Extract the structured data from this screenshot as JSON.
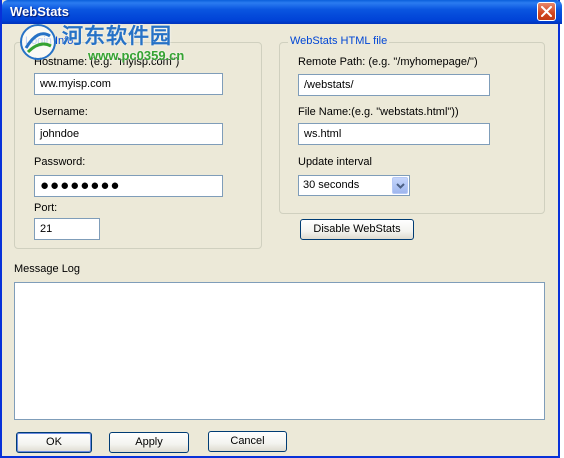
{
  "window": {
    "title": "WebStats"
  },
  "watermark": {
    "site_name": "河东软件园",
    "url": "www.pc0359.cn"
  },
  "login_info": {
    "group_title": "Login Info",
    "hostname_label": "Hostname: (e.g. \"myisp.com\")",
    "hostname_value": "ww.myisp.com",
    "username_label": "Username:",
    "username_value": "johndoe",
    "password_label": "Password:",
    "password_value": "●●●●●●●●",
    "port_label": "Port:",
    "port_value": "21"
  },
  "html_file": {
    "group_title": "WebStats HTML file",
    "remote_path_label": "Remote Path: (e.g. \"/myhomepage/\")",
    "remote_path_value": "/webstats/",
    "file_name_label": "File Name:(e.g. \"webstats.html\"))",
    "file_name_value": "ws.html",
    "update_interval_label": "Update interval",
    "update_interval_value": "30 seconds"
  },
  "disable_button_label": "Disable WebStats",
  "message_log": {
    "label": "Message Log"
  },
  "footer": {
    "ok_label": "OK",
    "apply_label": "Apply",
    "cancel_label": "Cancel"
  },
  "colors": {
    "title_bar": "#0a55e0",
    "group_title": "#0046d5",
    "dialog_bg": "#ece9d8",
    "close_button": "#d2461f"
  },
  "icons": {
    "close": "close-icon",
    "dropdown": "chevron-down-icon"
  }
}
